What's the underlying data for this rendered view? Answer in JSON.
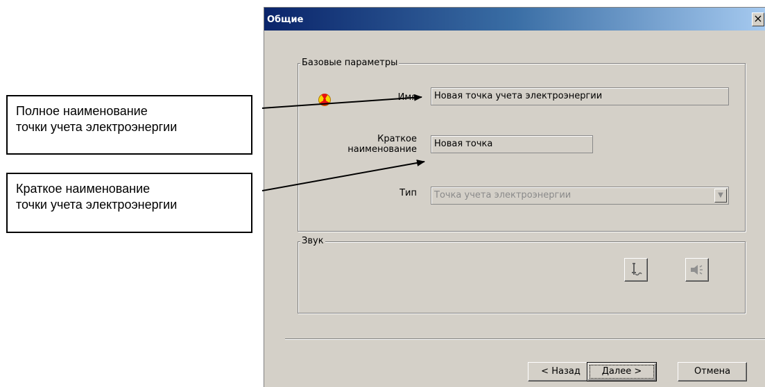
{
  "callouts": {
    "full_name": [
      "Полное наименование",
      "точки учета электроэнергии"
    ],
    "short_name": [
      "Краткое  наименование",
      "точки учета электроэнергии"
    ]
  },
  "window": {
    "title": "Общие",
    "close_label": "×"
  },
  "base_group": {
    "legend": "Базовые параметры",
    "name_label": "Имя",
    "name_value": "Новая точка учета электроэнергии",
    "short_label_1": "Краткое",
    "short_label_2": "наименование",
    "short_value": "Новая точка",
    "type_label": "Тип",
    "type_value": "Точка учета электроэнергии",
    "type_disabled": true
  },
  "sound_group": {
    "legend": "Звук",
    "buttons": [
      "choose-sound-icon",
      "play-sound-icon"
    ]
  },
  "footer": {
    "back_label": "< Назад",
    "next_label": "Далее >",
    "cancel_label": "Отмена"
  },
  "colors": {
    "titlebar_start": "#0a246a",
    "titlebar_end": "#a6caf0",
    "dialog_bg": "#d4d0c8",
    "hazard_yellow": "#f5d800",
    "hazard_red": "#e81010"
  }
}
